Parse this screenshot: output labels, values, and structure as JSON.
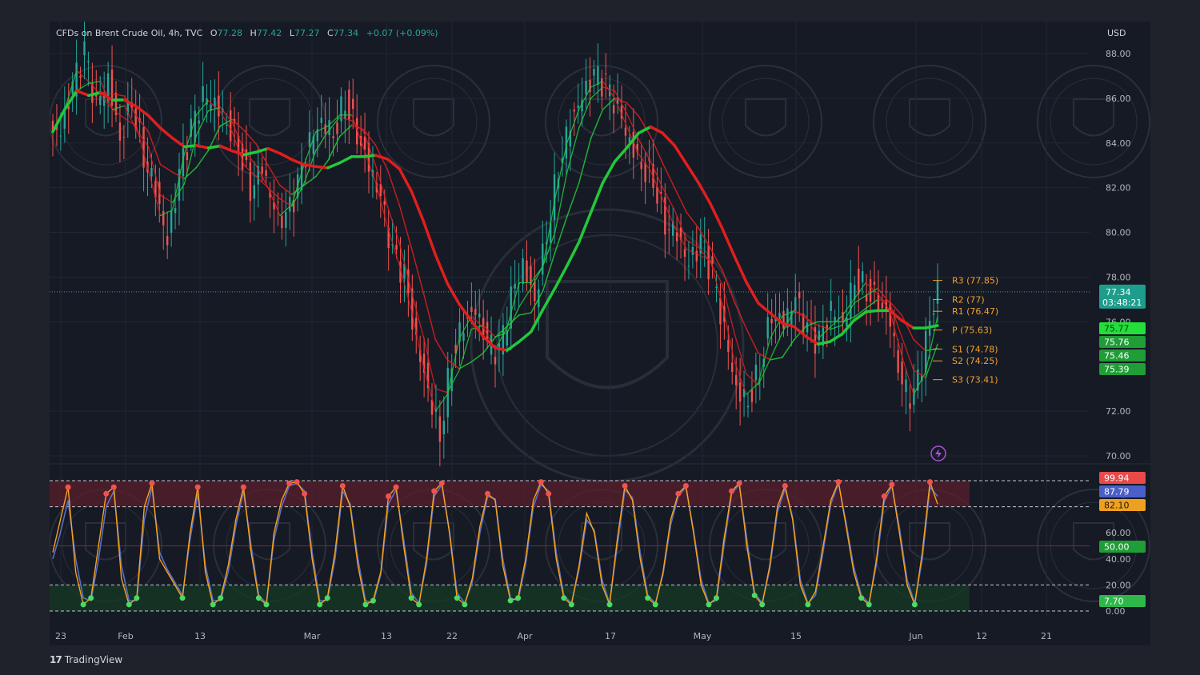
{
  "header": {
    "symbol": "CFDs on Brent Crude Oil, 4h, TVC",
    "o_label": "O",
    "o_value": "77.28",
    "h_label": "H",
    "h_value": "77.42",
    "l_label": "L",
    "l_value": "77.27",
    "c_label": "C",
    "c_value": "77.34",
    "change": "+0.07 (+0.09%)"
  },
  "currency": "USD",
  "brand": "TradingView",
  "colors": {
    "up": "#26a69a",
    "down": "#ef5350",
    "ma_up": "#22c93a",
    "ma_down": "#e01e1e",
    "pivot": "#f0a030",
    "stoch_k": "#f7a21b",
    "stoch_d": "#5b6fc7"
  },
  "chart_data": [
    {
      "type": "line",
      "title": "CFDs on Brent Crude Oil, 4h, TVC",
      "x_ticks": [
        "23",
        "Feb",
        "13",
        "Mar",
        "13",
        "22",
        "Apr",
        "17",
        "May",
        "15",
        "Jun",
        "12",
        "21"
      ],
      "y_ticks": [
        "88.00",
        "86.00",
        "84.00",
        "82.00",
        "80.00",
        "78.00",
        "76.00",
        "72.00",
        "70.00"
      ],
      "ylim": [
        70,
        89
      ],
      "series": [
        {
          "name": "close",
          "values": [
            84.5,
            86.5,
            88.0,
            85.5,
            86.8,
            84.2,
            86.0,
            83.5,
            82.0,
            79.5,
            82.5,
            84.5,
            86.0,
            85.8,
            85.0,
            84.0,
            82.0,
            83.0,
            81.0,
            80.5,
            82.0,
            84.0,
            85.0,
            84.5,
            86.0,
            84.5,
            83.0,
            81.5,
            79.0,
            78.0,
            75.0,
            73.0,
            71.0,
            74.5,
            76.0,
            76.5,
            75.0,
            74.5,
            77.0,
            78.5,
            77.0,
            80.0,
            83.0,
            85.0,
            86.0,
            87.0,
            86.5,
            85.5,
            84.0,
            83.0,
            82.5,
            80.5,
            80.0,
            78.5,
            79.5,
            78.0,
            75.5,
            73.0,
            72.5,
            74.0,
            76.5,
            76.0,
            77.0,
            75.5,
            75.0,
            76.5,
            76.0,
            78.0,
            77.5,
            77.0,
            76.0,
            73.0,
            72.5,
            75.0,
            77.5
          ]
        }
      ],
      "current_price": "77.34",
      "countdown": "03:48:21",
      "pivots": [
        {
          "name": "R3",
          "value": 77.85,
          "label": "R3 (77.85)"
        },
        {
          "name": "R2",
          "value": 77.0,
          "label": "R2 (77)"
        },
        {
          "name": "R1",
          "value": 76.47,
          "label": "R1 (76.47)"
        },
        {
          "name": "P",
          "value": 75.63,
          "label": "P (75.63)"
        },
        {
          "name": "S1",
          "value": 74.78,
          "label": "S1 (74.78)"
        },
        {
          "name": "S2",
          "value": 74.25,
          "label": "S2 (74.25)"
        },
        {
          "name": "S3",
          "value": 73.41,
          "label": "S3 (73.41)"
        }
      ],
      "ma_badges": [
        {
          "value": 75.77,
          "label": "75.77",
          "color": "#22e03a"
        },
        {
          "value": 75.76,
          "label": "75.76",
          "color": "#1f9d36"
        },
        {
          "value": 75.46,
          "label": "75.46",
          "color": "#1f9d36"
        },
        {
          "value": 75.39,
          "label": "75.39",
          "color": "#1f9d36"
        }
      ]
    },
    {
      "type": "line",
      "title": "",
      "y_ticks": [
        "60.00",
        "40.00",
        "20.00",
        "0.00"
      ],
      "ylim": [
        0,
        100
      ],
      "bands": {
        "overbought": 80,
        "oversold": 20,
        "mid": 50
      },
      "series": [
        {
          "name": "K",
          "values": [
            45,
            70,
            95,
            30,
            5,
            10,
            50,
            90,
            95,
            25,
            5,
            10,
            80,
            98,
            40,
            30,
            20,
            10,
            60,
            95,
            30,
            5,
            10,
            35,
            70,
            95,
            45,
            10,
            5,
            60,
            85,
            98,
            99,
            90,
            40,
            5,
            10,
            45,
            96,
            80,
            35,
            5,
            8,
            30,
            88,
            95,
            50,
            10,
            5,
            40,
            92,
            98,
            60,
            10,
            5,
            25,
            65,
            90,
            85,
            35,
            8,
            10,
            40,
            85,
            99,
            90,
            40,
            10,
            5,
            35,
            75,
            60,
            20,
            5,
            55,
            96,
            85,
            40,
            10,
            5,
            30,
            70,
            90,
            96,
            60,
            20,
            5,
            10,
            55,
            92,
            98,
            50,
            12,
            5,
            35,
            80,
            96,
            70,
            20,
            5,
            15,
            50,
            85,
            99,
            65,
            30,
            10,
            5,
            40,
            88,
            97,
            60,
            20,
            5,
            45,
            99,
            82
          ]
        },
        {
          "name": "D",
          "values": [
            40,
            60,
            85,
            40,
            10,
            8,
            40,
            80,
            92,
            35,
            8,
            8,
            70,
            95,
            45,
            32,
            22,
            12,
            55,
            90,
            35,
            8,
            8,
            30,
            65,
            92,
            50,
            12,
            6,
            55,
            80,
            96,
            98,
            92,
            45,
            8,
            8,
            40,
            92,
            82,
            40,
            8,
            6,
            28,
            82,
            93,
            55,
            14,
            6,
            36,
            88,
            97,
            62,
            14,
            6,
            22,
            60,
            88,
            86,
            40,
            10,
            8,
            36,
            80,
            97,
            92,
            45,
            12,
            6,
            32,
            70,
            62,
            24,
            6,
            50,
            93,
            87,
            45,
            12,
            6,
            28,
            66,
            88,
            95,
            62,
            24,
            6,
            8,
            50,
            90,
            97,
            55,
            14,
            6,
            32,
            76,
            94,
            72,
            24,
            6,
            12,
            46,
            82,
            98,
            68,
            34,
            12,
            6,
            36,
            84,
            96,
            64,
            24,
            6,
            40,
            95,
            88
          ]
        }
      ],
      "labels": {
        "k_last": "99.94",
        "d_last": "87.79",
        "level": "82.10",
        "mid_label": "50.00",
        "low_label": "7.70"
      }
    }
  ]
}
